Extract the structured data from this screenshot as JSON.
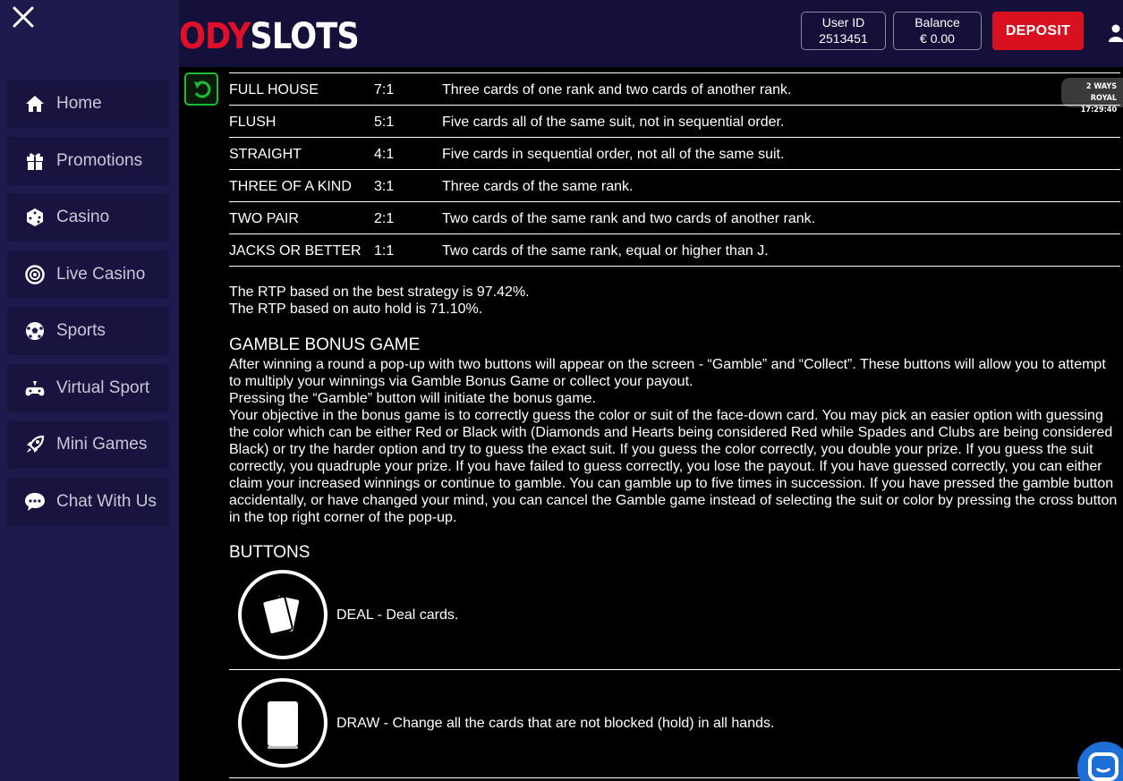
{
  "header": {
    "logo_left": "ODY",
    "logo_right": "SLOTS",
    "user_id_label": "User ID",
    "user_id_value": "2513451",
    "balance_label": "Balance",
    "balance_value": "€ 0.00",
    "deposit_label": "DEPOSIT"
  },
  "sidebar": {
    "items": [
      {
        "label": "Home",
        "icon": "home-icon"
      },
      {
        "label": "Promotions",
        "icon": "gift-icon"
      },
      {
        "label": "Casino",
        "icon": "dice-icon"
      },
      {
        "label": "Live Casino",
        "icon": "roulette-icon"
      },
      {
        "label": "Sports",
        "icon": "soccer-ball-icon"
      },
      {
        "label": "Virtual Sport",
        "icon": "gamepad-icon"
      },
      {
        "label": "Mini Games",
        "icon": "rocket-icon"
      },
      {
        "label": "Chat With Us",
        "icon": "chat-icon"
      }
    ]
  },
  "game_badge": {
    "title": "2 WAYS ROYAL",
    "time": "17:29:40"
  },
  "paytable": [
    {
      "hand": "FULL HOUSE",
      "pays": "7:1",
      "desc": "Three cards of one rank and two cards of another rank."
    },
    {
      "hand": "FLUSH",
      "pays": "5:1",
      "desc": "Five cards all of the same suit, not in sequential order."
    },
    {
      "hand": "STRAIGHT",
      "pays": "4:1",
      "desc": "Five cards in sequential order, not all of the same suit."
    },
    {
      "hand": "THREE OF A KIND",
      "pays": "3:1",
      "desc": "Three cards of the same rank."
    },
    {
      "hand": "TWO PAIR",
      "pays": "2:1",
      "desc": "Two cards of the same rank and two cards of another rank."
    },
    {
      "hand": "JACKS OR BETTER",
      "pays": "1:1",
      "desc": "Two cards of the same rank, equal or higher than J."
    }
  ],
  "rtp": {
    "best": "The RTP based on the best strategy is 97.42%.",
    "auto": "The RTP based on auto hold is 71.10%."
  },
  "gamble": {
    "title": "GAMBLE BONUS GAME",
    "p1": "After winning a round a pop-up with two buttons will appear on the screen - “Gamble” and “Collect”. These buttons will allow you to attempt to multiply your winnings via Gamble Bonus Game or collect your payout.",
    "p2": "Pressing the “Gamble” button will initiate the bonus game.",
    "p3": "Your objective in the bonus game is to correctly guess the color or suit of the face-down card. You may pick an easier option with guessing the color which can be either Red or Black with (Diamonds and Hearts being considered Red while Spades and Clubs are being considered Black) or try the harder option and try to guess the exact suit. If you guess the color correctly, you double your prize. If you guess the suit correctly, you quadruple your prize. If you have failed to guess correctly, you lose the payout. If you have guessed correctly, you can either claim your increased winnings or continue to gamble. You can gamble up to five times in succession. If you have pressed the gamble button accidentally, or have changed your mind, you can cancel the Gamble game instead of selecting the suit or color by pressing the cross button in the top right corner of the pop-up."
  },
  "buttons": {
    "title": "BUTTONS",
    "deal": "DEAL - Deal cards.",
    "draw": "DRAW - Change all the cards that are not blocked (hold) in all hands."
  }
}
